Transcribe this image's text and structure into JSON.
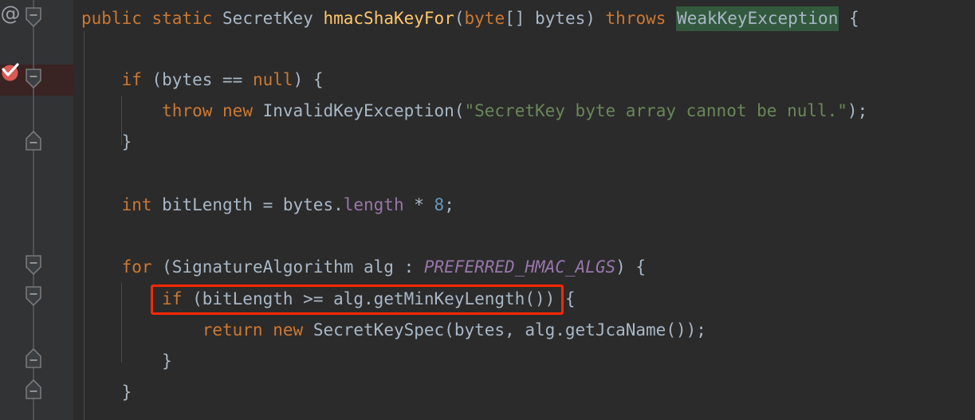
{
  "editor": {
    "language": "java",
    "theme": "darcula",
    "background": "#2b2b2b",
    "gutter_background": "#313335",
    "default_text_color": "#a9b7c6"
  },
  "colors": {
    "keyword": "#cc7832",
    "method": "#ffc66d",
    "string": "#6a8759",
    "number": "#6897bb",
    "field": "#9876aa",
    "static_field": "#9876aa",
    "plain": "#a9b7c6",
    "usage_highlight_bg": "#32593d",
    "caret_row_bg": "#3a2323",
    "annotation_box": "#fe2800",
    "fold_marker": "#787878",
    "gutter_icon_run": "#d95a54",
    "at_marker": "#9aa0a6"
  },
  "gutter": {
    "icons": [
      {
        "name": "annotation-at-icon",
        "glyph": "@",
        "line": 1
      },
      {
        "name": "run-test-icon",
        "glyph": "check-in-circle",
        "line": 2
      }
    ],
    "fold_markers": [
      {
        "line": 1,
        "type": "region-start",
        "state": "expanded",
        "symbol": "-"
      },
      {
        "line": 2,
        "type": "region-start",
        "state": "expanded",
        "symbol": "-"
      },
      {
        "line": 4,
        "type": "region-end",
        "state": "expanded",
        "symbol": "-"
      },
      {
        "line": 8,
        "type": "region-start",
        "state": "expanded",
        "symbol": "-"
      },
      {
        "line": 9,
        "type": "region-start",
        "state": "expanded",
        "symbol": "-"
      },
      {
        "line": 11,
        "type": "region-end",
        "state": "expanded",
        "symbol": "-"
      },
      {
        "line": 12,
        "type": "region-end",
        "state": "expanded",
        "symbol": "-"
      }
    ]
  },
  "code": {
    "line1": {
      "t1": "public",
      "t2": " ",
      "t3": "static",
      "t4": " ",
      "t5": "SecretKey",
      "t6": " ",
      "t7": "hmacShaKeyFor",
      "t8": "(",
      "t9": "byte",
      "t10": "[] bytes) ",
      "t11": "throws",
      "t12": " ",
      "t13": "WeakKeyException",
      "t14": " {"
    },
    "line2": {
      "indent": "    ",
      "t1": "if",
      "t2": " (bytes ",
      "t3": "==",
      "t4": " ",
      "t5": "null",
      "t6": ") {"
    },
    "line3": {
      "indent": "        ",
      "t1": "throw",
      "t2": " ",
      "t3": "new",
      "t4": " InvalidKeyException(",
      "t5": "\"SecretKey byte array cannot be null.\"",
      "t6": ");"
    },
    "line4": {
      "indent": "    ",
      "t1": "}"
    },
    "line5": {
      "text": ""
    },
    "line6": {
      "indent": "    ",
      "t1": "int",
      "t2": " bitLength = bytes.",
      "t3": "length",
      "t4": " * ",
      "t5": "8",
      "t6": ";"
    },
    "line7": {
      "text": ""
    },
    "line8": {
      "indent": "    ",
      "t1": "for",
      "t2": " (SignatureAlgorithm alg : ",
      "t3": "PREFERRED_HMAC_ALGS",
      "t4": ") {"
    },
    "line9": {
      "indent": "        ",
      "t1": "if",
      "t2": " (bitLength >= alg.getMinKeyLength()) {"
    },
    "line10": {
      "indent": "            ",
      "t1": "return",
      "t2": " ",
      "t3": "new",
      "t4": " SecretKeySpec(bytes, alg.getJcaName());"
    },
    "line11": {
      "indent": "        ",
      "t1": "}"
    },
    "line12": {
      "indent": "    ",
      "t1": "}"
    }
  },
  "annotations": {
    "highlight_box": {
      "label": "if (bitLength >= alg.getMinKeyLength()) {",
      "color": "#fe2800",
      "line": 9
    },
    "usage_highlight": {
      "label": "WeakKeyException",
      "color": "#32593d",
      "line": 1
    },
    "caret_row": {
      "label": "if (bytes == null) {",
      "color": "#3a2323",
      "line": 2
    }
  }
}
